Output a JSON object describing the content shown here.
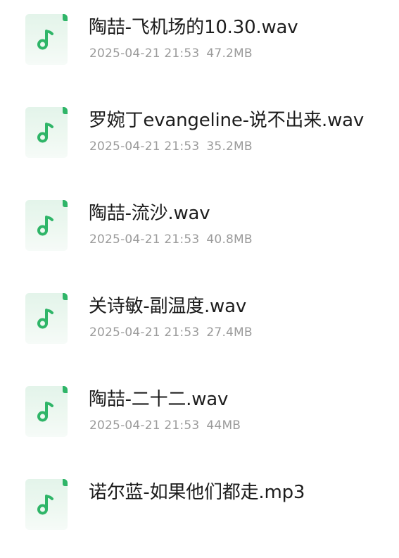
{
  "files": [
    {
      "name": "陶喆-飞机场的10.30.wav",
      "datetime": "2025-04-21 21:53",
      "size": "47.2MB",
      "icon": "music-note-icon"
    },
    {
      "name": "罗婉丁evangeline-说不出来.wav",
      "datetime": "2025-04-21 21:53",
      "size": "35.2MB",
      "icon": "music-note-icon"
    },
    {
      "name": "陶喆-流沙.wav",
      "datetime": "2025-04-21 21:53",
      "size": "40.8MB",
      "icon": "music-note-icon"
    },
    {
      "name": "关诗敏-副温度.wav",
      "datetime": "2025-04-21 21:53",
      "size": "27.4MB",
      "icon": "music-note-icon"
    },
    {
      "name": "陶喆-二十二.wav",
      "datetime": "2025-04-21 21:53",
      "size": "44MB",
      "icon": "music-note-icon"
    },
    {
      "name": "诺尔蓝-如果他们都走.mp3",
      "datetime": "",
      "size": "",
      "icon": "music-note-icon"
    }
  ],
  "colors": {
    "accent": "#2fb568",
    "icon_bg": "#e8f6ee",
    "name_text": "#1c1c1c",
    "meta_text": "#9b9b9b",
    "background": "#ffffff"
  }
}
